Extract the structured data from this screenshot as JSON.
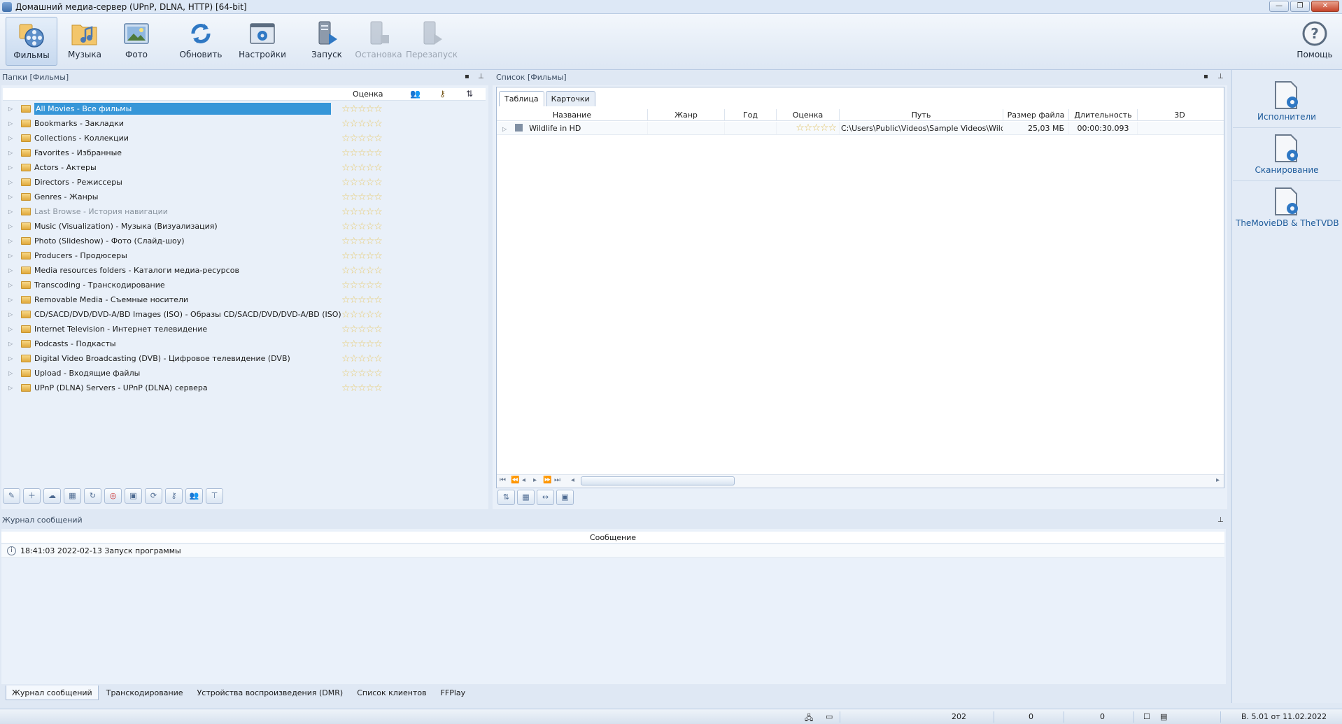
{
  "window": {
    "title": "Домашний медиа-сервер (UPnP, DLNA, HTTP) [64-bit]",
    "buttons": [
      "—",
      "❐",
      "✕"
    ]
  },
  "toolbar": {
    "movies": "Фильмы",
    "music": "Музыка",
    "photo": "Фото",
    "refresh": "Обновить",
    "settings": "Настройки",
    "start": "Запуск",
    "stop": "Остановка",
    "restart": "Перезапуск",
    "help": "Помощь"
  },
  "folders": {
    "header": "Папки [Фильмы]",
    "rating_col": "Оценка",
    "items": [
      {
        "label": "All Movies - Все фильмы",
        "selected": true
      },
      {
        "label": "Bookmarks - Закладки"
      },
      {
        "label": "Collections - Коллекции"
      },
      {
        "label": "Favorites - Избранные"
      },
      {
        "label": "Actors - Актеры"
      },
      {
        "label": "Directors - Режиссеры"
      },
      {
        "label": "Genres - Жанры"
      },
      {
        "label": "Last Browse - История навигации",
        "dim": true
      },
      {
        "label": "Music (Visualization) - Музыка (Визуализация)"
      },
      {
        "label": "Photo (Slideshow) - Фото (Слайд-шоу)"
      },
      {
        "label": "Producers - Продюсеры"
      },
      {
        "label": "Media resources folders - Каталоги медиа-ресурсов"
      },
      {
        "label": "Transcoding - Транскодирование"
      },
      {
        "label": "Removable Media - Съемные носители"
      },
      {
        "label": "CD/SACD/DVD/DVD-A/BD Images (ISO) - Образы CD/SACD/DVD/DVD-A/BD (ISO)"
      },
      {
        "label": "Internet Television - Интернет телевидение"
      },
      {
        "label": "Podcasts - Подкасты"
      },
      {
        "label": "Digital Video Broadcasting (DVB) - Цифровое телевидение (DVB)"
      },
      {
        "label": "Upload - Входящие файлы"
      },
      {
        "label": "UPnP (DLNA) Servers - UPnP (DLNA) сервера"
      }
    ]
  },
  "list": {
    "header": "Список [Фильмы]",
    "tabs": [
      "Таблица",
      "Карточки"
    ],
    "columns": [
      "Название",
      "Жанр",
      "Год",
      "Оценка",
      "Путь",
      "Размер файла",
      "Длительность",
      "3D"
    ],
    "rows": [
      {
        "name": "Wildlife in HD",
        "genre": "",
        "year": "",
        "path": "C:\\Users\\Public\\Videos\\Sample Videos\\Wildlife.w",
        "size": "25,03 МБ",
        "duration": "00:00:30.093",
        "three_d": ""
      }
    ]
  },
  "right_panel": {
    "performers": "Исполнители",
    "scanning": "Сканирование",
    "moviedb": "TheMovieDB & TheTVDB"
  },
  "log": {
    "header": "Журнал сообщений",
    "column": "Сообщение",
    "entries": [
      "18:41:03 2022-02-13 Запуск программы"
    ]
  },
  "bottom_tabs": [
    "Журнал сообщений",
    "Транскодирование",
    "Устройства воспроизведения (DMR)",
    "Список клиентов",
    "FFPlay"
  ],
  "status": {
    "count1": "202",
    "count2": "0",
    "count3": "0",
    "version": "В. 5.01 от 11.02.2022"
  }
}
